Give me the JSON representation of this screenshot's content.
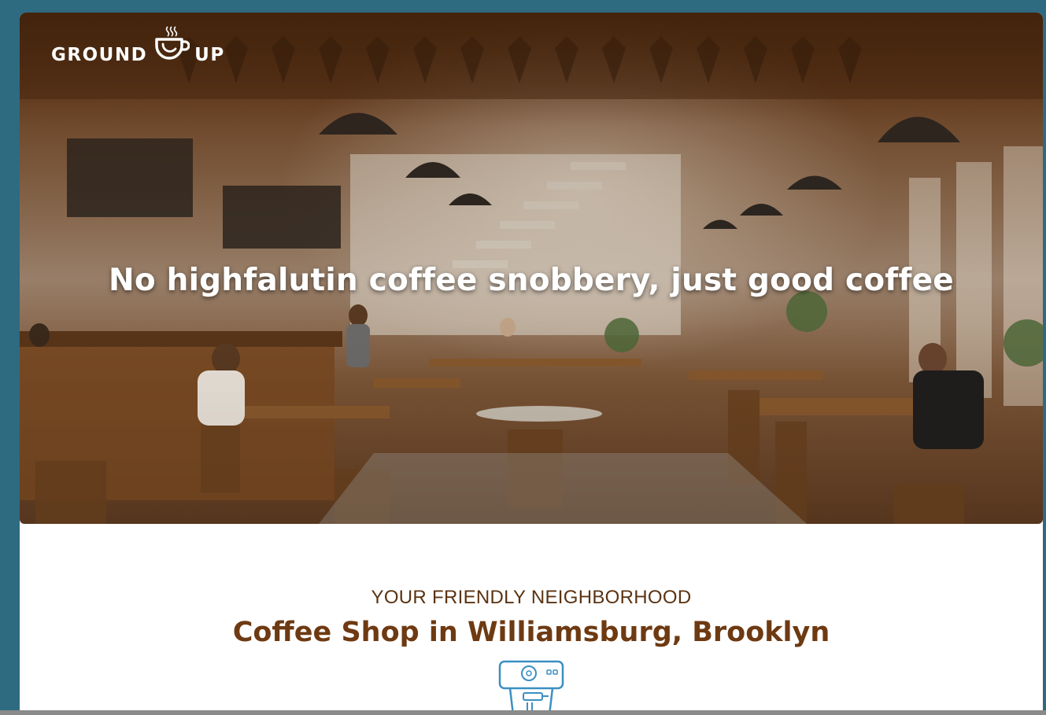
{
  "logo": {
    "left_word": "GROUND",
    "right_word": "UP",
    "icon": "coffee-cup-icon"
  },
  "hero": {
    "headline": "No highfalutin coffee snobbery, just good coffee"
  },
  "intro": {
    "eyebrow": "YOUR FRIENDLY NEIGHBORHOOD",
    "title": "Coffee Shop in Williamsburg, Brooklyn",
    "icon": "espresso-machine-icon"
  },
  "colors": {
    "frame": "#2e6a80",
    "title_brown": "#6e3a12",
    "eyebrow_brown": "#5b3312",
    "icon_blue": "#3b8fc2"
  }
}
